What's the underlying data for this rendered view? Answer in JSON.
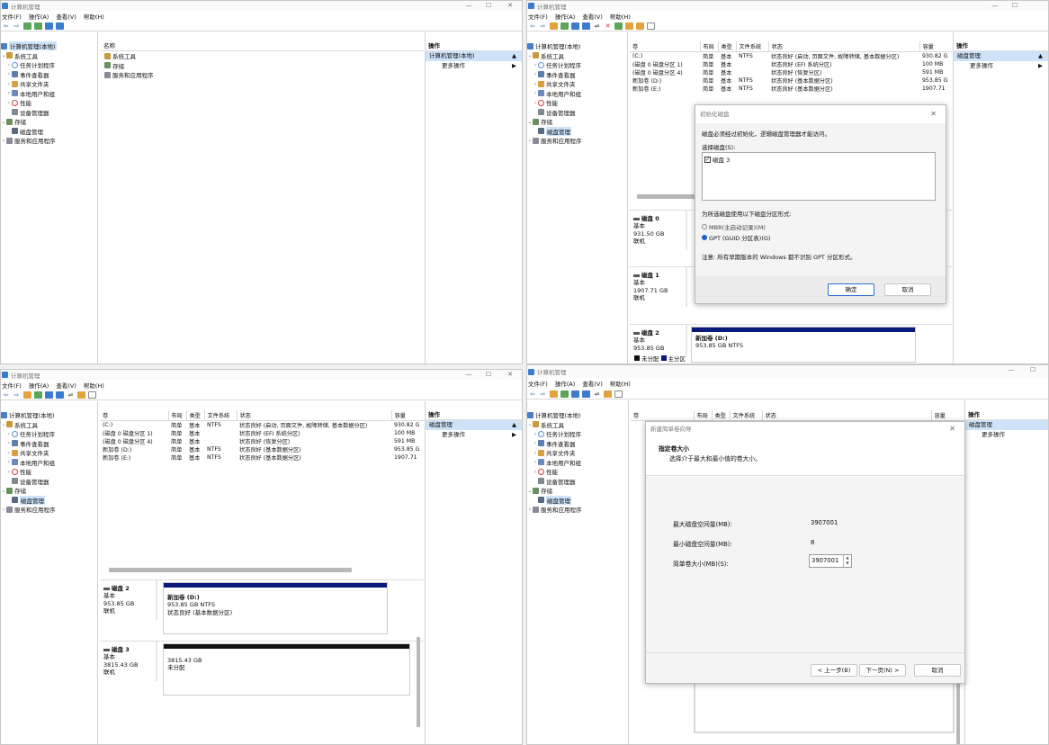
{
  "app": {
    "title": "计算机管理",
    "min_glyph": "—",
    "max_glyph": "☐",
    "close_glyph": "✕"
  },
  "menu": {
    "file": "文件(F)",
    "action": "操作(A)",
    "view": "查看(V)",
    "help": "帮助(H)"
  },
  "tree": {
    "expand_glyph": "›",
    "collapse_glyph": "⌄",
    "root": "计算机管理(本地)",
    "system_tools": "系统工具",
    "task_scheduler": "任务计划程序",
    "event_viewer": "事件查看器",
    "shared_folders": "共享文件夹",
    "local_users": "本地用户和组",
    "performance": "性能",
    "device_manager": "设备管理器",
    "storage": "存储",
    "disk_management": "磁盘管理",
    "services": "服务和应用程序"
  },
  "panel1": {
    "list_header": "名称",
    "items": [
      "系统工具",
      "存储",
      "服务和应用程序"
    ],
    "actions_header": "操作",
    "actions_selected": "计算机管理(本地)",
    "actions_more": "更多操作"
  },
  "actions": {
    "header": "操作",
    "selected": "磁盘管理",
    "more": "更多操作",
    "up_glyph": "▲",
    "right_glyph": "▶"
  },
  "volumes": {
    "headers": [
      "卷",
      "布局",
      "类型",
      "文件系统",
      "状态",
      "容量"
    ],
    "rows": [
      [
        "(C:)",
        "简单",
        "基本",
        "NTFS",
        "状态良好 (启动, 页面文件, 故障转储, 基本数据分区)",
        "930.82 G"
      ],
      [
        "(磁盘 0 磁盘分区 1)",
        "简单",
        "基本",
        "",
        "状态良好 (EFI 系统分区)",
        "100 MB"
      ],
      [
        "(磁盘 0 磁盘分区 4)",
        "简单",
        "基本",
        "",
        "状态良好 (恢复分区)",
        "591 MB"
      ],
      [
        "新加卷 (D:)",
        "简单",
        "基本",
        "NTFS",
        "状态良好 (基本数据分区)",
        "953.85 G"
      ],
      [
        "新加卷 (E:)",
        "简单",
        "基本",
        "NTFS",
        "状态良好 (基本数据分区)",
        "1907.71"
      ]
    ]
  },
  "disks": {
    "disk0": {
      "name": "磁盘 0",
      "type": "基本",
      "size": "931.50 GB",
      "status": "联机"
    },
    "disk1": {
      "name": "磁盘 1",
      "type": "基本",
      "size": "1907.71 GB",
      "status": "联机"
    },
    "disk2": {
      "name": "磁盘 2",
      "type": "基本",
      "size": "953.85 GB",
      "status": "联机",
      "part_name": "新加卷 (D:)",
      "part_size": "953.85 GB NTFS",
      "part_status": "状态良好 (基本数据分区)"
    },
    "disk3": {
      "name": "磁盘 3",
      "type": "基本",
      "size": "3815.43 GB",
      "status": "联机",
      "part_size": "3815.43 GB",
      "part_status": "未分配"
    }
  },
  "legend": {
    "unallocated": "未分配",
    "primary": "主分区"
  },
  "init_dialog": {
    "title": "初始化磁盘",
    "message": "磁盘必须经过初始化，逻辑磁盘管理器才能访问。",
    "select_label": "选择磁盘(S):",
    "disk_item": "磁盘 3",
    "check_glyph": "✓",
    "style_label": "为所选磁盘使用以下磁盘分区形式:",
    "mbr": "MBR(主启动记录)(M)",
    "gpt": "GPT (GUID 分区表)(G)",
    "note": "注意: 所有早期版本的 Windows 都不识别 GPT 分区形式。",
    "ok": "确定",
    "cancel": "取消"
  },
  "wizard": {
    "title": "新建简单卷向导",
    "heading": "指定卷大小",
    "subheading": "选择介于最大和最小值的卷大小。",
    "max_label": "最大磁盘空间量(MB):",
    "max_value": "3907001",
    "min_label": "最小磁盘空间量(MB):",
    "min_value": "8",
    "size_label": "简单卷大小(MB)(S):",
    "size_value": "3907001",
    "spin_up": "▲",
    "spin_down": "▼",
    "back": "< 上一步(B)",
    "next": "下一页(N) >",
    "cancel": "取消"
  }
}
